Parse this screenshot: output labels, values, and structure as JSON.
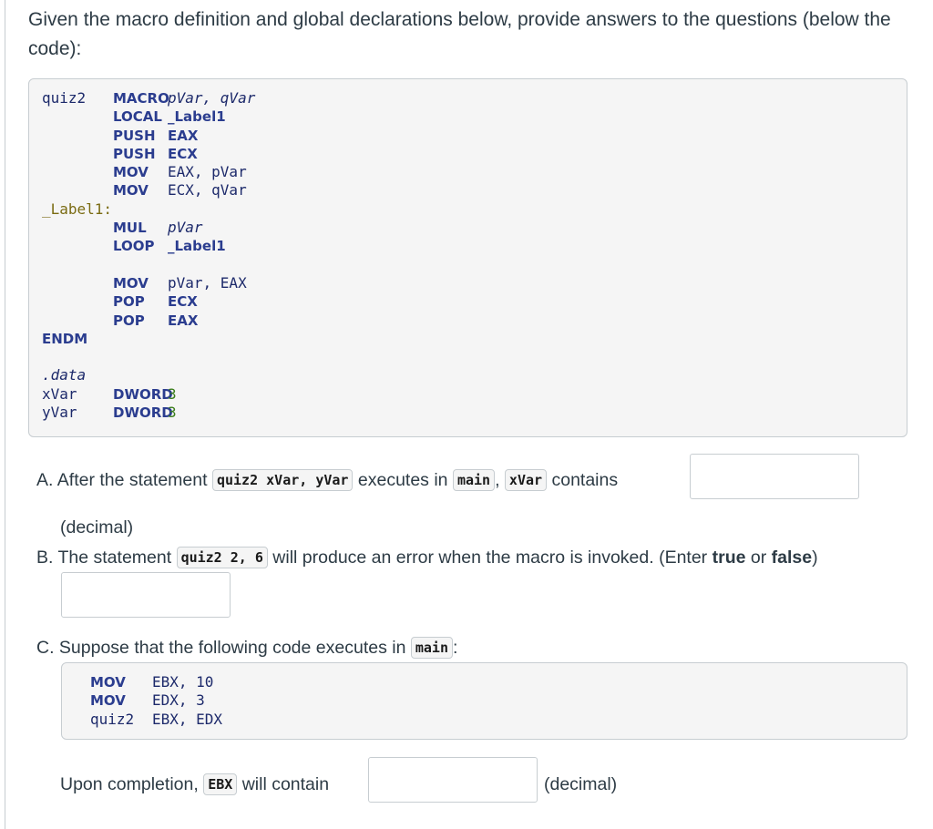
{
  "intro": "Given the macro definition and global declarations below, provide answers to the questions (below the code):",
  "code_lines": [
    [
      {
        "t": "quiz2",
        "c": "ident"
      },
      {
        "t": "MACRO",
        "c": "kw"
      },
      {
        "t": "pVar, qVar",
        "c": "ident-i"
      }
    ],
    [
      {
        "t": "",
        "c": ""
      },
      {
        "t": "LOCAL",
        "c": "kw"
      },
      {
        "t": "_Label1",
        "c": "kw"
      }
    ],
    [
      {
        "t": "",
        "c": ""
      },
      {
        "t": "PUSH",
        "c": "kw"
      },
      {
        "t": "EAX",
        "c": "kw"
      }
    ],
    [
      {
        "t": "",
        "c": ""
      },
      {
        "t": "PUSH",
        "c": "kw"
      },
      {
        "t": "ECX",
        "c": "kw"
      }
    ],
    [
      {
        "t": "",
        "c": ""
      },
      {
        "t": "MOV",
        "c": "kw"
      },
      {
        "t": "EAX, pVar",
        "c": "ident"
      }
    ],
    [
      {
        "t": "",
        "c": ""
      },
      {
        "t": "MOV",
        "c": "kw"
      },
      {
        "t": "ECX, qVar",
        "c": "ident"
      }
    ],
    [
      {
        "t": "_Label1:",
        "c": "lbl"
      }
    ],
    [
      {
        "t": "",
        "c": ""
      },
      {
        "t": "MUL",
        "c": "kw"
      },
      {
        "t": "pVar",
        "c": "ident-i"
      }
    ],
    [
      {
        "t": "",
        "c": ""
      },
      {
        "t": "LOOP",
        "c": "kw"
      },
      {
        "t": "_Label1",
        "c": "kw"
      }
    ],
    [],
    [
      {
        "t": "",
        "c": ""
      },
      {
        "t": "MOV",
        "c": "kw"
      },
      {
        "t": "pVar, EAX",
        "c": "ident"
      }
    ],
    [
      {
        "t": "",
        "c": ""
      },
      {
        "t": "POP",
        "c": "kw"
      },
      {
        "t": "ECX",
        "c": "kw"
      }
    ],
    [
      {
        "t": "",
        "c": ""
      },
      {
        "t": "POP",
        "c": "kw"
      },
      {
        "t": "EAX",
        "c": "kw"
      }
    ],
    [
      {
        "t": "ENDM",
        "c": "kw"
      }
    ],
    [],
    [
      {
        "t": ".data",
        "c": "dir"
      }
    ],
    [
      {
        "t": "xVar",
        "c": "ident"
      },
      {
        "t": "DWORD",
        "c": "kw"
      },
      {
        "t": "3",
        "c": "num"
      }
    ],
    [
      {
        "t": "yVar",
        "c": "ident"
      },
      {
        "t": "DWORD",
        "c": "kw"
      },
      {
        "t": "3",
        "c": "num"
      }
    ]
  ],
  "question_a": {
    "prefix": "A. After the statement",
    "code1": "quiz2 xVar, yVar",
    "mid": "executes in",
    "code2": "main",
    "comma": ",",
    "code3": "xVar",
    "suffix": "contains",
    "unit": "(decimal)",
    "answer": ""
  },
  "question_b": {
    "prefix": "B. The statement",
    "code": "quiz2 2, 6",
    "suffix1": "will produce an error when the macro is invoked. (Enter",
    "bold1": "true",
    "or": "or",
    "bold2": "false",
    "close": ")",
    "answer": ""
  },
  "question_c": {
    "prefix": "C. Suppose that the following code executes in",
    "code": "main",
    "colon": ":",
    "code_lines": [
      [
        {
          "t": "MOV",
          "c": "kw"
        },
        {
          "t": "EBX, 10",
          "c": "ident"
        }
      ],
      [
        {
          "t": "MOV",
          "c": "kw"
        },
        {
          "t": "EDX, 3",
          "c": "ident"
        }
      ],
      [
        {
          "t": "quiz2",
          "c": "ident"
        },
        {
          "t": "EBX, EDX",
          "c": "ident"
        }
      ]
    ],
    "upon": "Upon completion,",
    "reg": "EBX",
    "will": "will contain",
    "unit": "(decimal)",
    "answer": ""
  }
}
